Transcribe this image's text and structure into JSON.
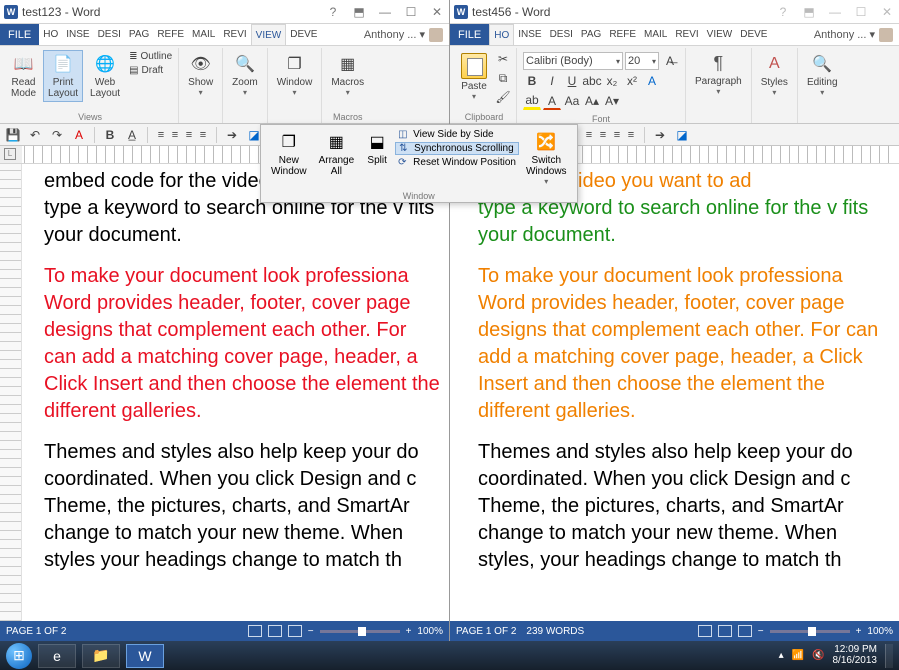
{
  "left_window": {
    "title": "test123 - Word",
    "tabs": {
      "file": "FILE",
      "ho": "HO",
      "inse": "INSE",
      "desi": "DESI",
      "pag": "PAG",
      "refe": "REFE",
      "mail": "MAIL",
      "revi": "REVI",
      "view": "VIEW",
      "deve": "DEVE"
    },
    "account": "Anthony ... ▾",
    "ribbon": {
      "views_group": "Views",
      "read_mode": "Read\nMode",
      "print_layout": "Print\nLayout",
      "web_layout": "Web\nLayout",
      "outline": "Outline",
      "draft": "Draft",
      "show": "Show",
      "zoom": "Zoom",
      "window": "Window",
      "macros": "Macros",
      "macros_group": "Macros"
    },
    "status": {
      "page": "PAGE 1 OF 2",
      "zoom": "100%"
    },
    "doc": {
      "p1": "embed code for the video you want to ad type a keyword to search online for the v fits your document.",
      "p2": "To make your document look professiona Word provides header, footer, cover page designs that complement each other. For can add a matching cover page, header, a Click Insert and then choose the element the different galleries.",
      "p3": "Themes and styles also help keep your do coordinated. When you click Design and c Theme, the pictures, charts, and SmartAr change to match your new theme. When styles  your headings change to match th"
    }
  },
  "right_window": {
    "title": "test456 - Word",
    "tabs": {
      "file": "FILE",
      "ho": "HO",
      "inse": "INSE",
      "desi": "DESI",
      "pag": "PAG",
      "refe": "REFE",
      "mail": "MAIL",
      "revi": "REVI",
      "view": "VIEW",
      "deve": "DEVE"
    },
    "account": "Anthony ... ▾",
    "ribbon": {
      "paste": "Paste",
      "clipboard": "Clipboard",
      "font_name": "Calibri (Body)",
      "font_size": "20",
      "font_group": "Font",
      "paragraph": "Paragraph",
      "styles": "Styles",
      "editing": "Editing"
    },
    "status": {
      "page": "PAGE 1 OF 2",
      "words": "239 WORDS",
      "zoom": "100%"
    },
    "doc": {
      "p1a": "de for the video you want to ad",
      "p1b": "type a keyword to search online for the v fits your document.",
      "p2": "To make your document look professiona Word provides header, footer, cover page designs that complement each other. For can add a matching cover page, header, a Click Insert and then choose the element the different galleries.",
      "p3": "Themes and styles also help keep your do coordinated. When you click Design and c Theme, the pictures, charts, and SmartAr change to match your new theme. When styles, your headings change to match th"
    }
  },
  "float": {
    "new_window": "New\nWindow",
    "arrange_all": "Arrange\nAll",
    "split": "Split",
    "side_by_side": "View Side by Side",
    "sync": "Synchronous Scrolling",
    "reset": "Reset Window Position",
    "switch": "Switch\nWindows",
    "group_label": "Window"
  },
  "taskbar": {
    "time": "12:09 PM",
    "date": "8/16/2013"
  }
}
